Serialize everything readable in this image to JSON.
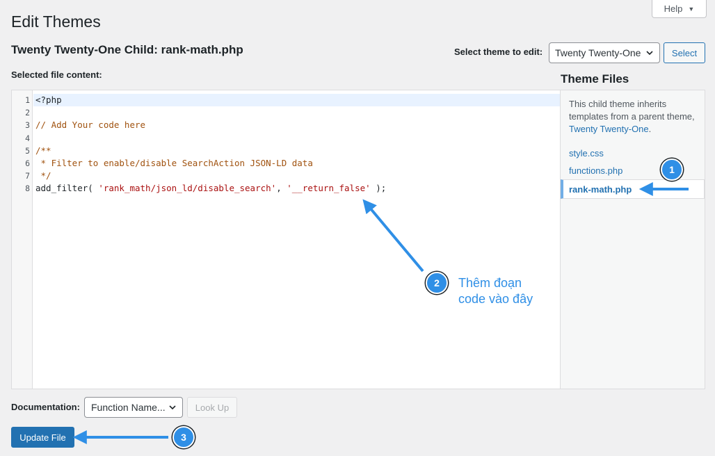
{
  "header": {
    "help_label": "Help",
    "page_title": "Edit Themes",
    "file_title": "Twenty Twenty-One Child: rank-math.php",
    "select_theme_label": "Select theme to edit:",
    "theme_selected": "Twenty Twenty-One",
    "select_button": "Select"
  },
  "editor": {
    "label": "Selected file content:",
    "lines": [
      {
        "n": "1",
        "tokens": [
          {
            "t": "<?php",
            "c": "meta"
          }
        ]
      },
      {
        "n": "2",
        "tokens": []
      },
      {
        "n": "3",
        "tokens": [
          {
            "t": "// Add Your code here",
            "c": "comment"
          }
        ]
      },
      {
        "n": "4",
        "tokens": []
      },
      {
        "n": "5",
        "tokens": [
          {
            "t": "/**",
            "c": "comment"
          }
        ]
      },
      {
        "n": "6",
        "tokens": [
          {
            "t": " * Filter to enable/disable SearchAction JSON-LD data",
            "c": "comment"
          }
        ]
      },
      {
        "n": "7",
        "tokens": [
          {
            "t": " */",
            "c": "comment"
          }
        ]
      },
      {
        "n": "8",
        "tokens": [
          {
            "t": "add_filter( ",
            "c": "fn"
          },
          {
            "t": "'rank_math/json_ld/disable_search'",
            "c": "str"
          },
          {
            "t": ", ",
            "c": "fn"
          },
          {
            "t": "'__return_false'",
            "c": "str"
          },
          {
            "t": " );",
            "c": "fn"
          }
        ]
      }
    ]
  },
  "theme_files": {
    "title": "Theme Files",
    "note_prefix": "This child theme inherits templates from a parent theme, ",
    "note_link": "Twenty Twenty-One",
    "note_suffix": ".",
    "files": [
      "style.css",
      "functions.php"
    ],
    "active_file": "rank-math.php"
  },
  "footer": {
    "documentation_label": "Documentation:",
    "function_select": "Function Name...",
    "lookup_button": "Look Up",
    "update_button": "Update File"
  },
  "annotations": {
    "badge_1": "1",
    "badge_2": "2",
    "badge_3": "3",
    "note_line1": "Thêm đoạn",
    "note_line2": "code vào đây",
    "color": "#2f8fe6"
  },
  "colors": {
    "primary": "#2271b1",
    "background": "#f0f0f1",
    "active_border": "#72aee6"
  }
}
